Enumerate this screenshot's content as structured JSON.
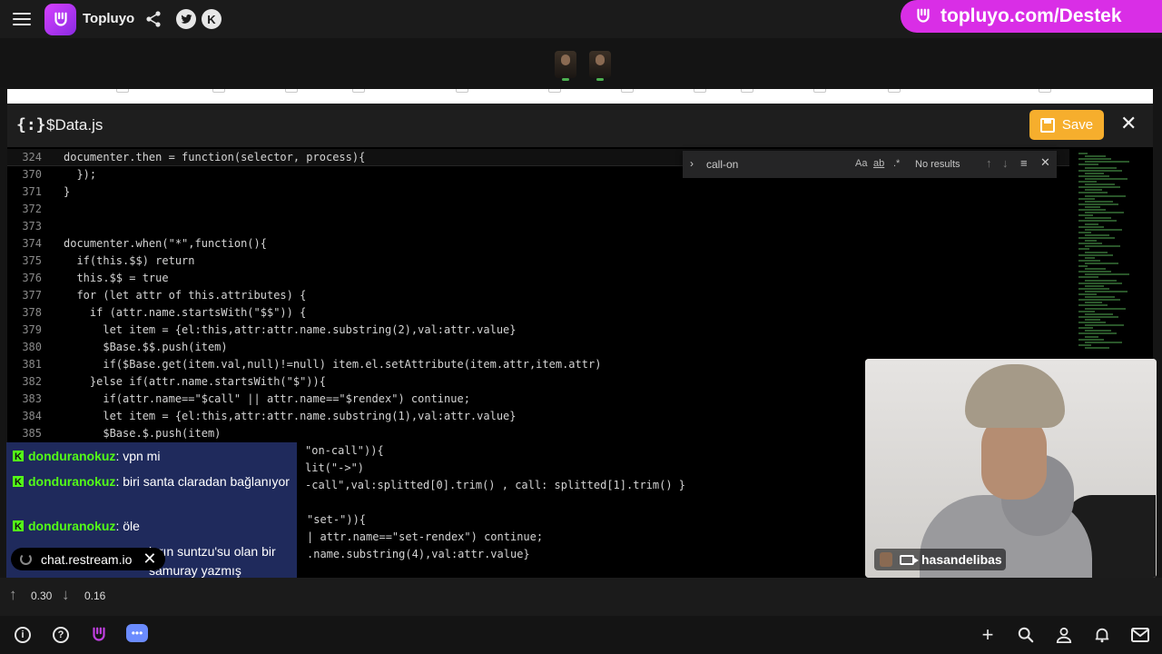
{
  "app": {
    "brand": "Topluyo",
    "promo": "topluyo.com/Destek"
  },
  "editor": {
    "filename": "$Data.js",
    "save_label": "Save",
    "find": {
      "query": "call-on",
      "opt_case": "Aa",
      "opt_word": "ab",
      "opt_regex": ".*",
      "result": "No results"
    },
    "lines": [
      {
        "n": "324",
        "code": "documenter.then = function(selector, process){"
      },
      {
        "n": "370",
        "code": "  });"
      },
      {
        "n": "371",
        "code": "}"
      },
      {
        "n": "372",
        "code": ""
      },
      {
        "n": "373",
        "code": ""
      },
      {
        "n": "374",
        "code": "documenter.when(\"*\",function(){"
      },
      {
        "n": "375",
        "code": "  if(this.$$) return"
      },
      {
        "n": "376",
        "code": "  this.$$ = true"
      },
      {
        "n": "377",
        "code": "  for (let attr of this.attributes) {"
      },
      {
        "n": "378",
        "code": "    if (attr.name.startsWith(\"$$\")) {"
      },
      {
        "n": "379",
        "code": "      let item = {el:this,attr:attr.name.substring(2),val:attr.value}"
      },
      {
        "n": "380",
        "code": "      $Base.$$.push(item)"
      },
      {
        "n": "381",
        "code": "      if($Base.get(item.val,null)!=null) item.el.setAttribute(item.attr,item.attr)"
      },
      {
        "n": "382",
        "code": "    }else if(attr.name.startsWith(\"$\")){"
      },
      {
        "n": "383",
        "code": "      if(attr.name==\"$call\" || attr.name==\"$rendex\") continue;"
      },
      {
        "n": "384",
        "code": "      let item = {el:this,attr:attr.name.substring(1),val:attr.value}"
      },
      {
        "n": "385",
        "code": "      $Base.$.push(item)"
      }
    ],
    "hidden_fragments": [
      {
        "code": "\"on-call\")){"
      },
      {
        "code": "lit(\"->\")"
      },
      {
        "code": "-call\",val:splitted[0].trim() , call: splitted[1].trim() }"
      },
      {
        "code": "\"set-\")){"
      },
      {
        "code": "| attr.name==\"set-rendex\") continue;"
      },
      {
        "code": ".name.substring(4),val:attr.value}"
      }
    ]
  },
  "chat": {
    "messages": [
      {
        "user": "donduranokuz",
        "text": "vpn mi"
      },
      {
        "user": "donduranokuz",
        "text": "biri santa claradan bağlanıyor"
      },
      {
        "user": "donduranokuz",
        "text": "öle"
      },
      {
        "user": "",
        "text": "ların suntzu'su olan bir samuray yazmış"
      }
    ],
    "toast": "chat.restream.io"
  },
  "webcam": {
    "name": "hasandelibas"
  },
  "stats": {
    "up": "0.30",
    "down": "0.16"
  }
}
